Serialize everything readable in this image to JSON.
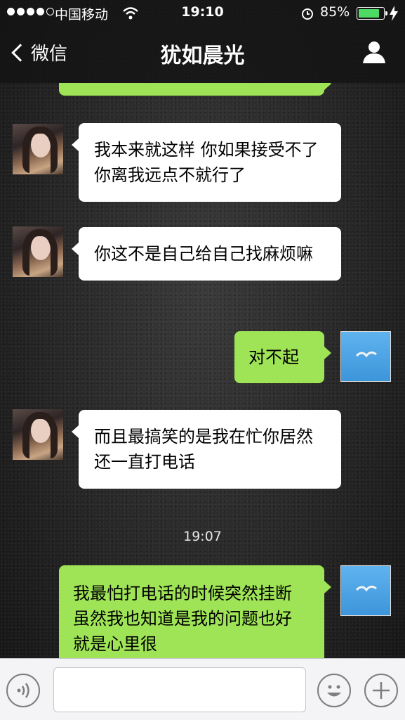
{
  "status_bar": {
    "carrier": "中国移动",
    "time": "19:10",
    "battery": "85%",
    "battery_level": 0.85,
    "battery_color": "#4cd964"
  },
  "nav": {
    "back_label": "微信",
    "title": "犹如晨光",
    "profile_icon": "profile-icon"
  },
  "messages": [
    {
      "side": "left",
      "sender": "her",
      "text": "我本来就这样 你如果接受不了你离我远点不就行了"
    },
    {
      "side": "left",
      "sender": "her",
      "text": "你这不是自己给自己找麻烦嘛"
    },
    {
      "side": "right",
      "sender": "me",
      "text": "对不起"
    },
    {
      "side": "left",
      "sender": "her",
      "text": "而且最搞笑的是我在忙你居然还一直打电话"
    },
    {
      "side": "right",
      "sender": "me",
      "text": "我最怕打电话的时候突然挂断　虽然我也知道是我的问题也好　就是心里很"
    }
  ],
  "timestamp": "19:07",
  "colors": {
    "bubble_right": "#9fe456",
    "bubble_left": "#ffffff",
    "my_avatar": "#4aa3e4"
  },
  "input_bar": {
    "voice_icon": "voice-icon",
    "emoji_icon": "emoji-icon",
    "plus_icon": "plus-icon",
    "text_value": ""
  }
}
